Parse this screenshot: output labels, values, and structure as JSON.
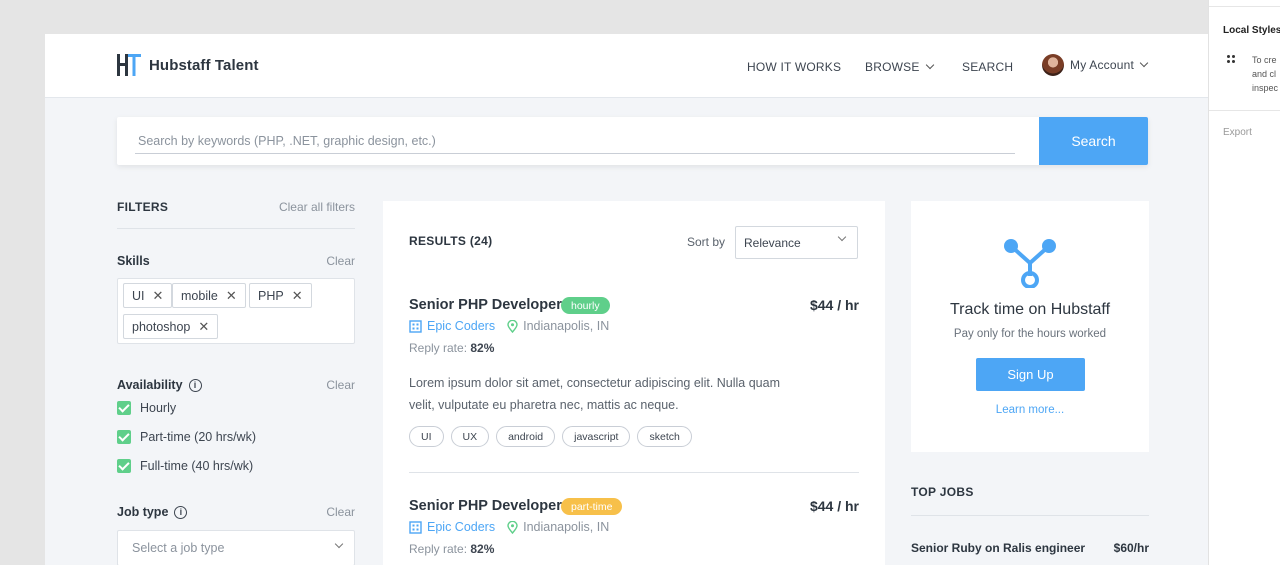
{
  "side_panel": {
    "title": "Local Styles",
    "hint_lines": [
      "To cre",
      "and cl",
      "inspec"
    ],
    "export_label": "Export"
  },
  "header": {
    "logo_text": "Hubstaff Talent",
    "nav": {
      "how_it_works": "HOW IT WORKS",
      "browse": "BROWSE",
      "search": "SEARCH",
      "account": "My Account"
    }
  },
  "search": {
    "placeholder": "Search by keywords (PHP, .NET, graphic design, etc.)",
    "value": "",
    "button_label": "Search"
  },
  "filters": {
    "title": "FILTERS",
    "clear_all": "Clear all filters",
    "skills": {
      "label": "Skills",
      "clear": "Clear",
      "chips": [
        "UI",
        "mobile",
        "PHP",
        "photoshop"
      ]
    },
    "availability": {
      "label": "Availability",
      "clear": "Clear",
      "options": [
        {
          "label": "Hourly",
          "checked": true
        },
        {
          "label": "Part-time (20 hrs/wk)",
          "checked": true
        },
        {
          "label": "Full-time (40 hrs/wk)",
          "checked": true
        }
      ]
    },
    "job_type": {
      "label": "Job type",
      "clear": "Clear",
      "placeholder": "Select a job type"
    }
  },
  "results": {
    "title": "RESULTS (24)",
    "sort_label": "Sort by",
    "sort_value": "Relevance",
    "jobs": [
      {
        "title": "Senior PHP Developer",
        "badge": "hourly",
        "rate": "$44 / hr",
        "company": "Epic Coders",
        "location": "Indianapolis, IN",
        "reply_label": "Reply rate:",
        "reply_value": "82%",
        "description": "Lorem ipsum dolor sit amet, consectetur adipiscing elit. Nulla quam velit, vulputate eu pharetra nec, mattis ac neque.",
        "tags": [
          "UI",
          "UX",
          "android",
          "javascript",
          "sketch"
        ]
      },
      {
        "title": "Senior PHP Developer",
        "badge": "part-time",
        "rate": "$44 / hr",
        "company": "Epic Coders",
        "location": "Indianapolis, IN",
        "reply_label": "Reply rate:",
        "reply_value": "82%"
      }
    ]
  },
  "promo": {
    "title": "Track time on Hubstaff",
    "subtitle": "Pay only for the hours worked",
    "signup_label": "Sign Up",
    "learn_more": "Learn more..."
  },
  "top_jobs": {
    "title": "TOP JOBS",
    "items": [
      {
        "title": "Senior Ruby on Ralis engineer",
        "rate": "$60/hr"
      }
    ]
  },
  "colors": {
    "accent": "#4da6f5",
    "green": "#5fcf8a",
    "yellow": "#f7c04a"
  }
}
